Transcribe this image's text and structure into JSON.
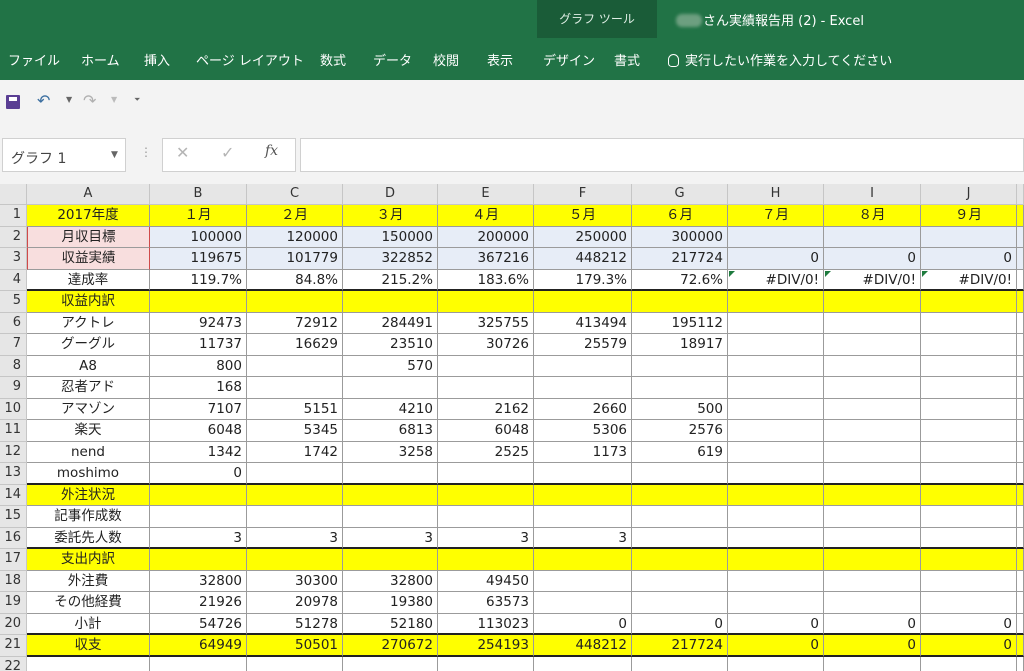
{
  "titlebar": {
    "tool_context": "グラフ ツール",
    "doc_title": "さん実績報告用 (2)  -  Excel"
  },
  "ribbon": {
    "tabs": [
      "ファイル",
      "ホーム",
      "挿入",
      "ページ レイアウト",
      "数式",
      "データ",
      "校閲",
      "表示",
      "デザイン",
      "書式"
    ],
    "tell_me": "実行したい作業を入力してください"
  },
  "formula_bar": {
    "name_box": "グラフ 1",
    "formula": ""
  },
  "grid": {
    "columns": [
      "A",
      "B",
      "C",
      "D",
      "E",
      "F",
      "G",
      "H",
      "I",
      "J"
    ],
    "rows": [
      {
        "n": "1",
        "style": "yellow",
        "a": "2017年度",
        "vals": [
          "１月",
          "２月",
          "３月",
          "４月",
          "５月",
          "６月",
          "７月",
          "８月",
          "９月"
        ]
      },
      {
        "n": "2",
        "style": "blue",
        "a": "月収目標",
        "vals": [
          "100000",
          "120000",
          "150000",
          "200000",
          "250000",
          "300000",
          "",
          "",
          ""
        ]
      },
      {
        "n": "3",
        "style": "blue",
        "a": "収益実績",
        "vals": [
          "119675",
          "101779",
          "322852",
          "367216",
          "448212",
          "217724",
          "0",
          "0",
          "0"
        ]
      },
      {
        "n": "4",
        "style": "plain",
        "a": "達成率",
        "vals": [
          "119.7%",
          "84.8%",
          "215.2%",
          "183.6%",
          "179.3%",
          "72.6%",
          "#DIV/0!",
          "#DIV/0!",
          "#DIV/0!"
        ]
      },
      {
        "n": "5",
        "style": "yellow",
        "a": "収益内訳",
        "vals": [
          "",
          "",
          "",
          "",
          "",
          "",
          "",
          "",
          ""
        ]
      },
      {
        "n": "6",
        "style": "plain",
        "a": "アクトレ",
        "vals": [
          "92473",
          "72912",
          "284491",
          "325755",
          "413494",
          "195112",
          "",
          "",
          ""
        ]
      },
      {
        "n": "7",
        "style": "plain",
        "a": "グーグル",
        "vals": [
          "11737",
          "16629",
          "23510",
          "30726",
          "25579",
          "18917",
          "",
          "",
          ""
        ]
      },
      {
        "n": "8",
        "style": "plain",
        "a": "A8",
        "vals": [
          "800",
          "",
          "570",
          "",
          "",
          "",
          "",
          "",
          ""
        ]
      },
      {
        "n": "9",
        "style": "plain",
        "a": "忍者アド",
        "vals": [
          "168",
          "",
          "",
          "",
          "",
          "",
          "",
          "",
          ""
        ]
      },
      {
        "n": "10",
        "style": "plain",
        "a": "アマゾン",
        "vals": [
          "7107",
          "5151",
          "4210",
          "2162",
          "2660",
          "500",
          "",
          "",
          ""
        ]
      },
      {
        "n": "11",
        "style": "plain",
        "a": "楽天",
        "vals": [
          "6048",
          "5345",
          "6813",
          "6048",
          "5306",
          "2576",
          "",
          "",
          ""
        ]
      },
      {
        "n": "12",
        "style": "plain",
        "a": "nend",
        "vals": [
          "1342",
          "1742",
          "3258",
          "2525",
          "1173",
          "619",
          "",
          "",
          ""
        ]
      },
      {
        "n": "13",
        "style": "plain",
        "a": "moshimo",
        "vals": [
          "0",
          "",
          "",
          "",
          "",
          "",
          "",
          "",
          ""
        ]
      },
      {
        "n": "14",
        "style": "yellow",
        "a": "外注状況",
        "vals": [
          "",
          "",
          "",
          "",
          "",
          "",
          "",
          "",
          ""
        ]
      },
      {
        "n": "15",
        "style": "plain",
        "a": "記事作成数",
        "vals": [
          "",
          "",
          "",
          "",
          "",
          "",
          "",
          "",
          ""
        ]
      },
      {
        "n": "16",
        "style": "plain",
        "a": "委託先人数",
        "vals": [
          "3",
          "3",
          "3",
          "3",
          "3",
          "",
          "",
          "",
          ""
        ]
      },
      {
        "n": "17",
        "style": "yellow",
        "a": "支出内訳",
        "vals": [
          "",
          "",
          "",
          "",
          "",
          "",
          "",
          "",
          ""
        ]
      },
      {
        "n": "18",
        "style": "plain",
        "a": "外注費",
        "vals": [
          "32800",
          "30300",
          "32800",
          "49450",
          "",
          "",
          "",
          "",
          ""
        ]
      },
      {
        "n": "19",
        "style": "plain",
        "a": "その他経費",
        "vals": [
          "21926",
          "20978",
          "19380",
          "63573",
          "",
          "",
          "",
          "",
          ""
        ]
      },
      {
        "n": "20",
        "style": "plain",
        "a": "小計",
        "vals": [
          "54726",
          "51278",
          "52180",
          "113023",
          "0",
          "0",
          "0",
          "0",
          "0"
        ]
      },
      {
        "n": "21",
        "style": "yellow",
        "a": "収支",
        "vals": [
          "64949",
          "50501",
          "270672",
          "254193",
          "448212",
          "217724",
          "0",
          "0",
          "0"
        ]
      },
      {
        "n": "22",
        "style": "plain",
        "a": "",
        "vals": [
          "",
          "",
          "",
          "",
          "",
          "",
          "",
          "",
          ""
        ]
      }
    ]
  },
  "colors": {
    "ribbon": "#217346",
    "highlight_yellow": "#ffff00",
    "input_blue": "#e7edf7",
    "pink": "#f8dede"
  }
}
